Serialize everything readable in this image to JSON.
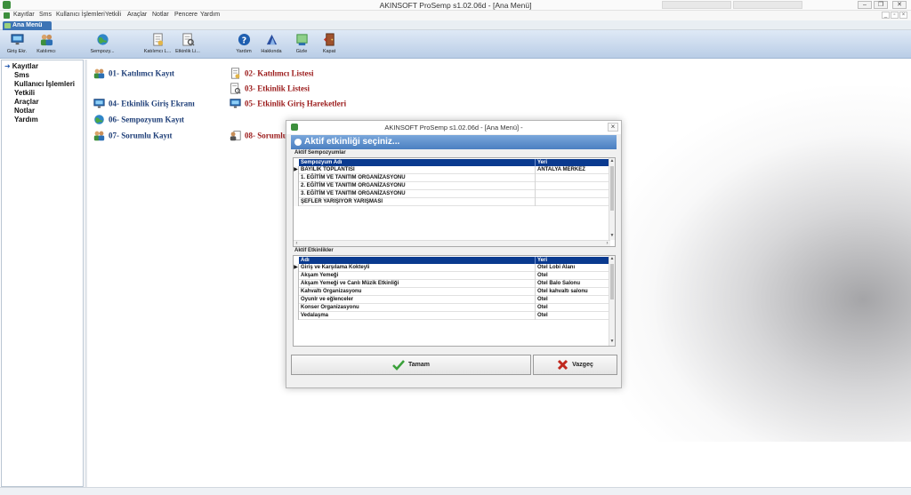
{
  "window": {
    "title": "AKINSOFT ProSemp s1.02.06d - [Ana Menü]"
  },
  "menu": {
    "items": [
      "Kayıtlar",
      "Sms",
      "Kullanıcı İşlemleri",
      "Yetkili",
      "Araçlar",
      "Notlar",
      "Pencere",
      "Yardım"
    ]
  },
  "tab": {
    "label": "Ana Menü"
  },
  "toolbar": {
    "buttons": [
      {
        "label": "Giriş Ekr.",
        "icon": "monitor-icon"
      },
      {
        "label": "Katılımcı",
        "icon": "users-icon"
      },
      {
        "label": "Sempozy...",
        "icon": "globe-icon"
      },
      {
        "label": "Katılımcı L...",
        "icon": "document-list-icon"
      },
      {
        "label": "Etkinlik Li...",
        "icon": "document-search-icon"
      },
      {
        "label": "Yardım",
        "icon": "help-icon"
      },
      {
        "label": "Hakkında",
        "icon": "info-icon"
      },
      {
        "label": "Gizle",
        "icon": "hide-icon"
      },
      {
        "label": "Kapat",
        "icon": "exit-door-icon"
      }
    ]
  },
  "tree": {
    "items": [
      "Kayıtlar",
      "Sms",
      "Kullanıcı İşlemleri",
      "Yetkili",
      "Araçlar",
      "Notlar",
      "Yardım"
    ]
  },
  "shortcuts": [
    {
      "label": "01- Katılımcı Kayıt",
      "color": "#1f3f78"
    },
    {
      "label": "02- Katılımcı Listesi",
      "color": "#9b1b1b"
    },
    {
      "label": "03- Etkinlik Listesi",
      "color": "#9b1b1b"
    },
    {
      "label": "04- Etkinlik Giriş Ekranı",
      "color": "#1f3f78"
    },
    {
      "label": "05- Etkinlik Giriş Hareketleri",
      "color": "#9b1b1b"
    },
    {
      "label": "06- Sempozyum Kayıt",
      "color": "#1f3f78"
    },
    {
      "label": "07- Sorumlu Kayıt",
      "color": "#1f3f78"
    },
    {
      "label": "08- Sorumlu",
      "color": "#9b1b1b"
    }
  ],
  "dialog": {
    "title": "AKINSOFT ProSemp s1.02.06d - [Ana Menü] -",
    "close_label": "×",
    "header": "Aktif etkinliği seçiniz...",
    "symposia": {
      "section_label": "Aktif Sempozyumlar",
      "columns": [
        "Sempozyum Adı",
        "Yeri"
      ],
      "rows": [
        [
          "BAYILIK TOPLANTISI",
          "ANTALYA MERKEZ"
        ],
        [
          "1. EĞİTİM VE TANITIM ORGANİZASYONU",
          ""
        ],
        [
          "2. EĞİTİM VE TANITIM ORGANİZASYONU",
          ""
        ],
        [
          "3. EĞİTİM VE TANITIM ORGANİZASYONU",
          ""
        ],
        [
          "ŞEFLER YARIŞIYOR YARIŞMASI",
          ""
        ]
      ]
    },
    "events": {
      "section_label": "Aktif Etkinlikler",
      "columns": [
        "Adı",
        "Yeri"
      ],
      "rows": [
        [
          "Giriş ve Karşılama Kokteyli",
          "Otel Lobi Alanı"
        ],
        [
          "Akşam Yemeği",
          "Otel"
        ],
        [
          "Akşam Yemeği ve Canlı Müzik Etkinliği",
          "Otel Balo Salonu"
        ],
        [
          "Kahvaltı Organizasyonu",
          "Otel kahvaltı salonu"
        ],
        [
          "Oyunlr ve eğlenceler",
          "Otel"
        ],
        [
          "Konser Organizasyonu",
          "Otel"
        ],
        [
          "Vedalaşma",
          "Otel"
        ]
      ]
    },
    "ok_label": "Tamam",
    "cancel_label": "Vazgeç"
  }
}
